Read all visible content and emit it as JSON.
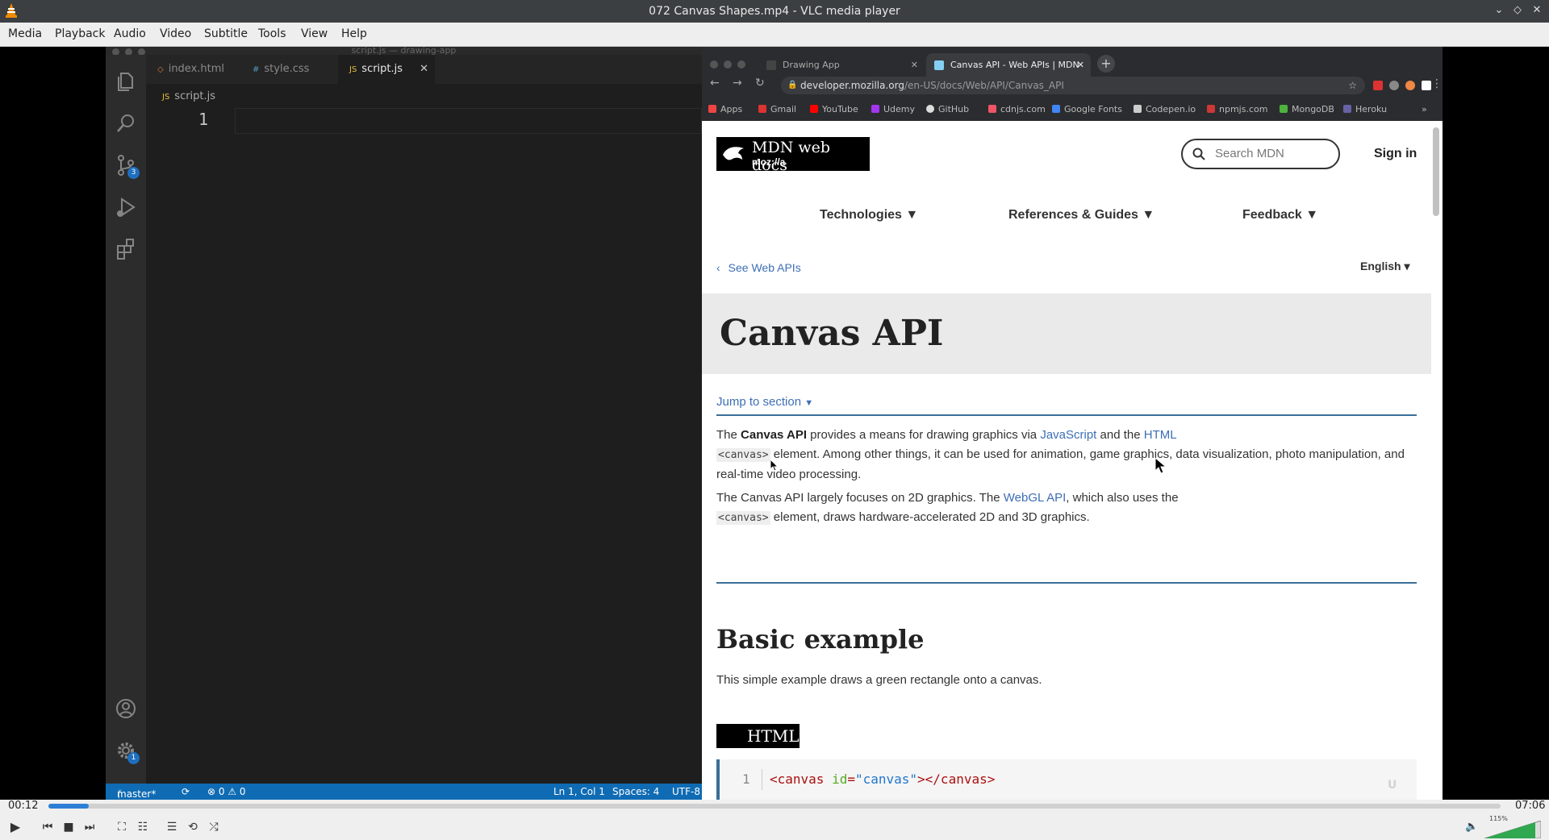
{
  "window": {
    "title": "072 Canvas Shapes.mp4 - VLC media player"
  },
  "menu": [
    "Media",
    "Playback",
    "Audio",
    "Video",
    "Subtitle",
    "Tools",
    "View",
    "Help"
  ],
  "vscode": {
    "window_title": "script.js — drawing-app",
    "tabs": [
      {
        "label": "index.html",
        "icon": "◇",
        "color": "#e37933"
      },
      {
        "label": "style.css",
        "icon": "#",
        "color": "#519aba"
      },
      {
        "label": "script.js",
        "icon": "JS",
        "color": "#e8c13c",
        "close": "✕"
      }
    ],
    "breadcrumb": "script.js",
    "breadcrumb_icon": "JS",
    "line_number": "1",
    "activity_badges": {
      "scm": "3",
      "settings": "1"
    },
    "status": {
      "branch": "master*",
      "errors": "⊗ 0 ⚠ 0",
      "position": "Ln 1, Col 1",
      "spaces": "Spaces: 4",
      "encoding": "UTF-8"
    }
  },
  "browser": {
    "tabs": [
      {
        "label": "Drawing App"
      },
      {
        "label": "Canvas API - Web APIs | MDN"
      }
    ],
    "url_host": "developer.mozilla.org",
    "url_path": "/en-US/docs/Web/API/Canvas_API",
    "bookmarks": [
      {
        "label": "Apps",
        "color": "#e44"
      },
      {
        "label": "Gmail",
        "color": "#d33"
      },
      {
        "label": "YouTube",
        "color": "#f00"
      },
      {
        "label": "Udemy",
        "color": "#a435f0"
      },
      {
        "label": "GitHub",
        "color": "#ddd"
      },
      {
        "label": "cdnjs.com",
        "color": "#e56"
      },
      {
        "label": "Google Fonts",
        "color": "#4285f4"
      },
      {
        "label": "Codepen.io",
        "color": "#ccc"
      },
      {
        "label": "npmjs.com",
        "color": "#cb3837"
      },
      {
        "label": "MongoDB",
        "color": "#4db33d"
      },
      {
        "label": "Heroku",
        "color": "#6762a6"
      }
    ]
  },
  "mdn": {
    "logo_name": "MDN web docs",
    "logo_sub": "moz://a",
    "search_placeholder": "Search MDN",
    "sign_in": "Sign in",
    "nav": [
      "Technologies ▼",
      "References & Guides ▼",
      "Feedback ▼"
    ],
    "see_link": "See Web APIs",
    "language": "English ▾",
    "title": "Canvas API",
    "jump": "Jump to section",
    "p1": {
      "a": "The ",
      "b": "Canvas API",
      "c": " provides a means for drawing graphics via ",
      "link1": "JavaScript",
      "d": " and the ",
      "link2": "HTML",
      "code": "<canvas>",
      "e": " element. Among other things, it can be used for animation, game graphics, data visualization, photo manipulation, and real-time video processing."
    },
    "p2": {
      "a": "The Canvas API largely focuses on 2D graphics. The ",
      "link": "WebGL API",
      "b": ", which also uses the ",
      "code": "<canvas>",
      "c": " element, draws hardware-accelerated 2D and 3D graphics."
    },
    "h2": "Basic example",
    "p3": "This simple example draws a green rectangle onto a canvas.",
    "html_tag": "HTML",
    "code_line_no": "1",
    "code": {
      "open": "<canvas ",
      "attr": "id",
      "eq": "=",
      "val": "\"canvas\"",
      "close": "></canvas>"
    }
  },
  "player": {
    "elapsed": "00:12",
    "total": "07:06",
    "progress": 0.028,
    "volume": "115%"
  }
}
